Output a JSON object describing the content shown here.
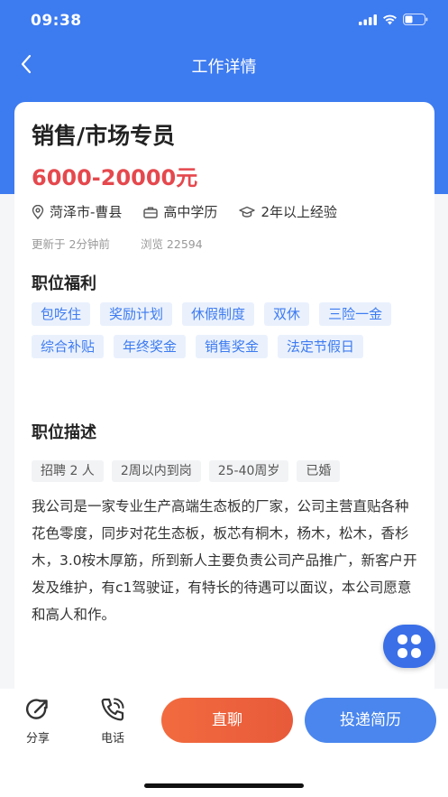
{
  "status": {
    "time": "09:38"
  },
  "nav": {
    "title": "工作详情"
  },
  "job": {
    "title": "销售/市场专员",
    "salary": "6000-20000元",
    "location": "菏泽市-曹县",
    "education": "高中学历",
    "experience": "2年以上经验",
    "updated": "更新于 2分钟前",
    "views": "浏览 22594"
  },
  "benefits": {
    "title": "职位福利",
    "tags": [
      "包吃住",
      "奖励计划",
      "休假制度",
      "双休",
      "三险一金",
      "综合补贴",
      "年终奖金",
      "销售奖金",
      "法定节假日"
    ]
  },
  "description": {
    "title": "职位描述",
    "requirements": [
      "招聘 2 人",
      "2周以内到岗",
      "25-40周岁",
      "已婚"
    ],
    "text": "我公司是一家专业生产高端生态板的厂家，公司主营直贴各种花色零度，同步对花生态板，板芯有桐木，杨木，松木，香杉木，3.0桉木厚筋，所到新人主要负责公司产品推广，新客户开发及维护，有c1驾驶证，有特长的待遇可以面议，本公司愿意和高人和作。"
  },
  "bottom": {
    "share_label": "分享",
    "phone_label": "电话",
    "chat_label": "直聊",
    "apply_label": "投递简历"
  },
  "colors": {
    "primary": "#3d7bf0",
    "salary": "#e5484d",
    "chat_button": "#ef6540"
  }
}
